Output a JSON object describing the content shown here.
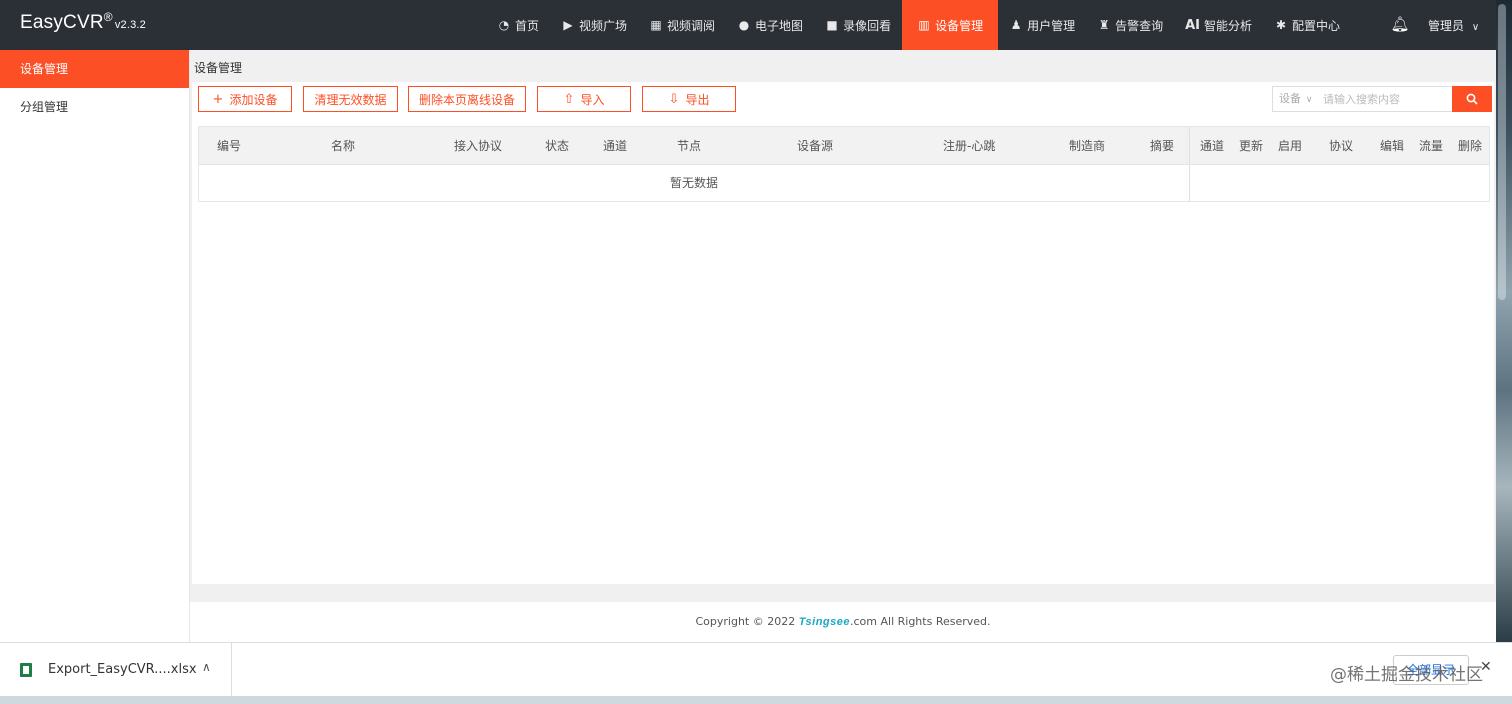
{
  "header": {
    "logo": "EasyCVR",
    "logo_mark": "®",
    "version": "v2.3.2",
    "nav": [
      {
        "label": "首页",
        "icon": "dashboard-icon"
      },
      {
        "label": "视频广场",
        "icon": "play-icon"
      },
      {
        "label": "视频调阅",
        "icon": "grid-icon"
      },
      {
        "label": "电子地图",
        "icon": "map-pin-icon"
      },
      {
        "label": "录像回看",
        "icon": "video-camera-icon"
      },
      {
        "label": "设备管理",
        "icon": "device-icon",
        "active": true
      },
      {
        "label": "用户管理",
        "icon": "user-icon"
      },
      {
        "label": "告警查询",
        "icon": "alarm-icon"
      },
      {
        "label": "智能分析",
        "icon": "ai-icon",
        "prefix": "AI"
      },
      {
        "label": "配置中心",
        "icon": "gear-icon"
      }
    ],
    "user": "管理员"
  },
  "sidebar": {
    "items": [
      {
        "label": "设备管理",
        "active": true
      },
      {
        "label": "分组管理"
      }
    ]
  },
  "main": {
    "breadcrumb": "设备管理",
    "toolbar": {
      "add": "添加设备",
      "clean": "清理无效数据",
      "delete_offline": "删除本页离线设备",
      "import": "导入",
      "export": "导出"
    },
    "search": {
      "scope": "设备",
      "placeholder": "请输入搜索内容"
    },
    "table": {
      "columns": [
        "编号",
        "名称",
        "接入协议",
        "状态",
        "通道",
        "节点",
        "设备源",
        "注册-心跳",
        "制造商",
        "摘要"
      ],
      "fixed_columns": [
        "通道",
        "更新",
        "启用",
        "协议",
        "编辑",
        "流量",
        "删除"
      ],
      "empty_text": "暂无数据"
    },
    "footer": {
      "prefix": "Copyright © 2022 ",
      "brand": "Tsingsee",
      "suffix": ".com All Rights Reserved."
    }
  },
  "download_shelf": {
    "file": "Export_EasyCVR....xlsx",
    "show_all": "全部显示"
  },
  "watermark": "@稀土掘金技术社区",
  "colors": {
    "accent": "#fd4f25",
    "topbar": "#2b2f36",
    "brand_link": "#1aa7c4"
  }
}
